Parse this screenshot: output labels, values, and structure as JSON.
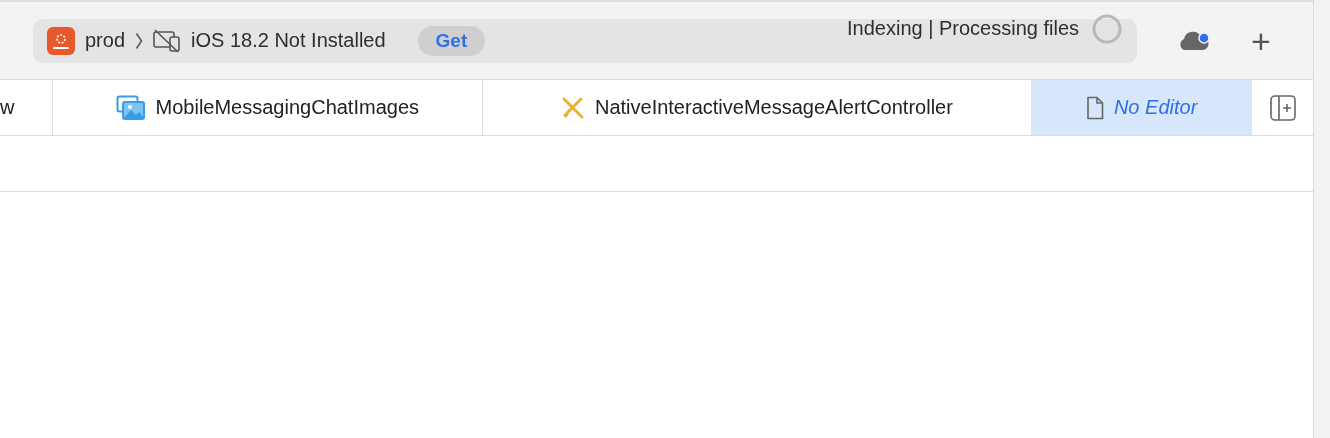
{
  "toolbar": {
    "scheme": "prod",
    "destination": "iOS 18.2 Not Installed",
    "get_button": "Get",
    "status": "Indexing | Processing files",
    "cloud_badge": true,
    "add_button": "+"
  },
  "tabs": [
    {
      "label": "w",
      "kind": "plain",
      "selected": false
    },
    {
      "label": "MobileMessagingChatImages",
      "kind": "images",
      "selected": false
    },
    {
      "label": "NativeInteractiveMessageAlertController",
      "kind": "tool",
      "selected": false
    },
    {
      "label": "No Editor",
      "kind": "document",
      "selected": true
    }
  ]
}
